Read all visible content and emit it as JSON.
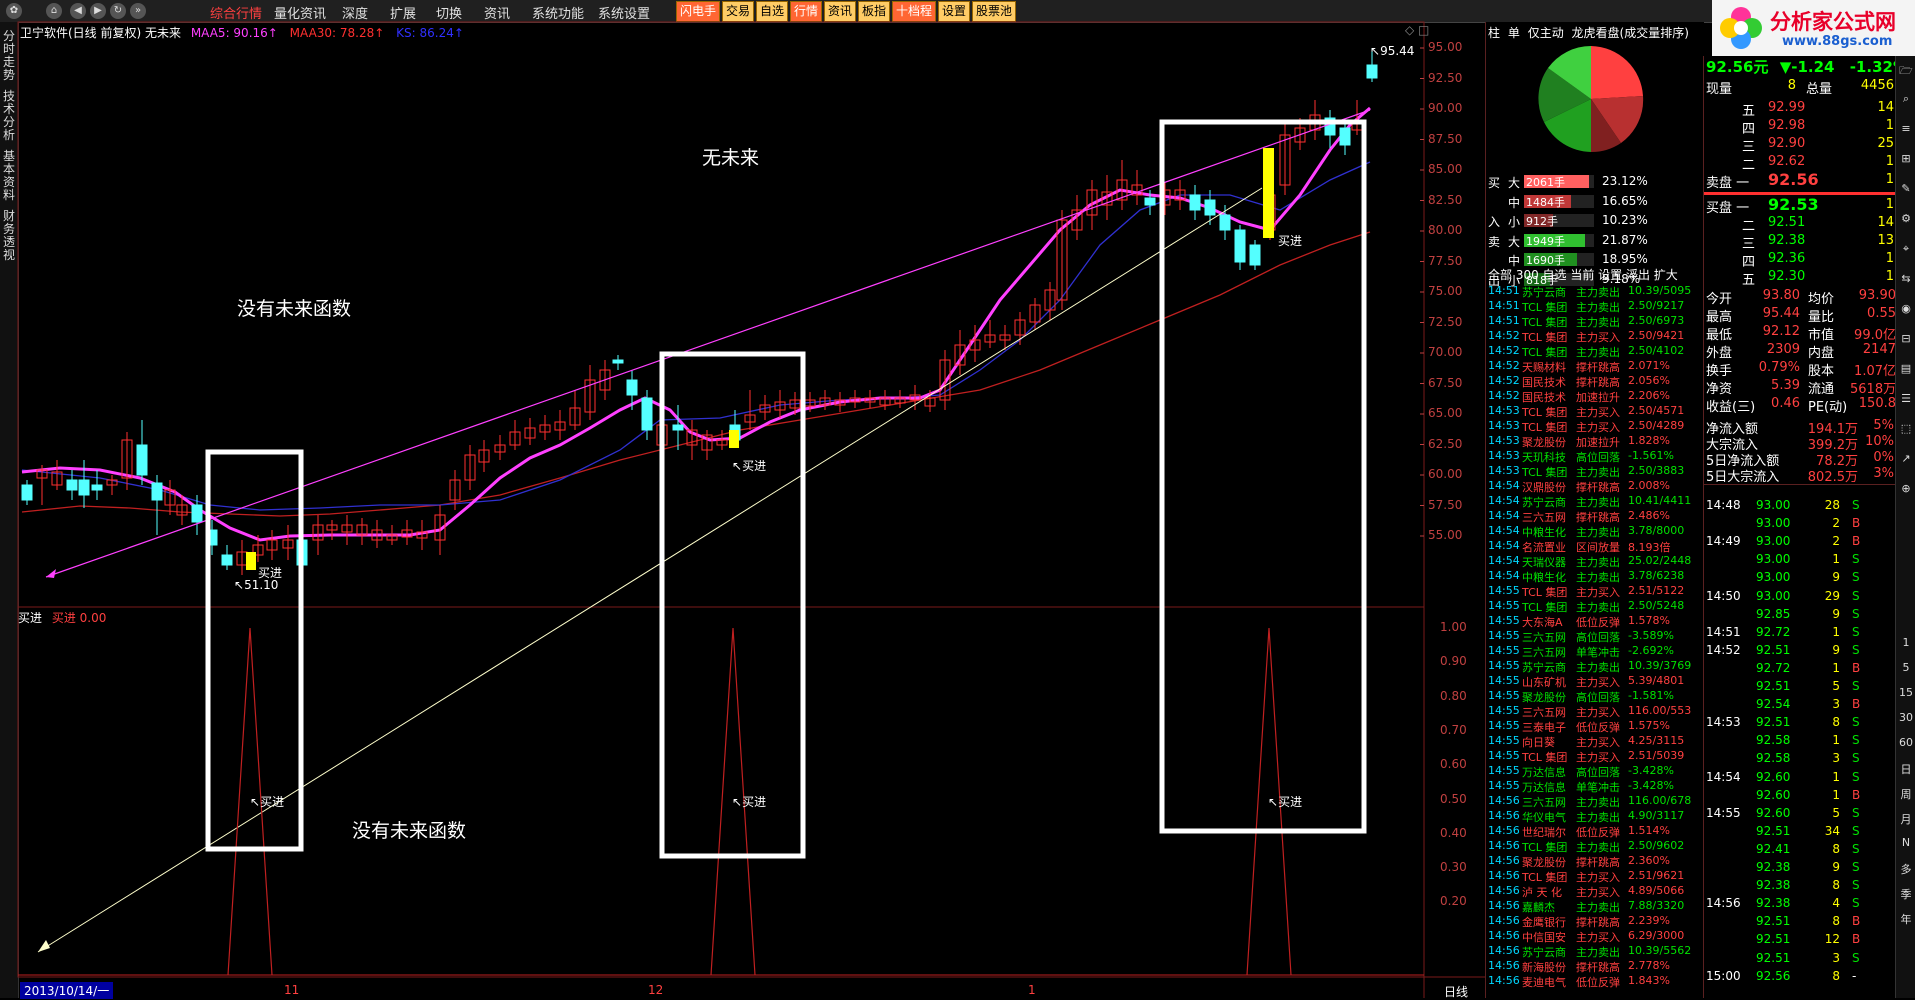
{
  "menu": {
    "items": [
      "综合行情",
      "量化资讯",
      "深度",
      "扩展",
      "切换",
      "资讯",
      "系统功能",
      "系统设置"
    ],
    "active": 0
  },
  "toolbar": {
    "buttons": [
      "闪电手",
      "交易",
      "自选",
      "行情",
      "资讯",
      "板指",
      "十档程",
      "设置",
      "股票池"
    ]
  },
  "logo": {
    "title": "分析家公式网",
    "url": "www.88gs.com"
  },
  "left_tabs": [
    "分时走势",
    "技术分析",
    "基本资料",
    "财务透视"
  ],
  "chart": {
    "title": "卫宁软件(日线 前复权) 无未来",
    "ma5": "MAA5: 90.16↑",
    "ma30": "MAA30: 78.28↑",
    "ks": "KS: 86.24↑",
    "high_label": "95.44",
    "low_label": "51.10",
    "buy_label": "买进",
    "annotation_top": "无未来",
    "annotation_mid": "没有未来函数",
    "annotation_bottom": "没有未来函数",
    "indicator_title": "买进",
    "indicator_value": "买进 0.00",
    "price_ticks": [
      "95.00",
      "92.50",
      "90.00",
      "87.50",
      "85.00",
      "82.50",
      "80.00",
      "77.50",
      "75.00",
      "72.50",
      "70.00",
      "67.50",
      "65.00",
      "62.50",
      "60.00",
      "57.50",
      "55.00"
    ],
    "ind_ticks": [
      "1.00",
      "0.90",
      "0.80",
      "0.70",
      "0.60",
      "0.50",
      "0.40",
      "0.30",
      "0.20"
    ],
    "date_start": "2013/10/14/一",
    "month_labels": [
      "11",
      "12",
      "1"
    ],
    "period": "日线",
    "colors": {
      "up": "#ff3030",
      "down": "#54ffff",
      "ma5": "#ff40ff",
      "ma30": "#c02020",
      "ks": "#3030d0"
    }
  },
  "mid": {
    "tabs": [
      "柱",
      "单",
      "仅主动",
      "龙虎看盘(成交量排序)"
    ],
    "flow": [
      {
        "side": "买",
        "size": "大",
        "vol": "2061手",
        "pct": "23.12%"
      },
      {
        "side": "",
        "size": "中",
        "vol": "1484手",
        "pct": "16.65%"
      },
      {
        "side": "入",
        "size": "小",
        "vol": "912手",
        "pct": "10.23%"
      },
      {
        "side": "卖",
        "size": "大",
        "vol": "1949手",
        "pct": "21.87%"
      },
      {
        "side": "",
        "size": "中",
        "vol": "1690手",
        "pct": "18.95%"
      },
      {
        "side": "出",
        "size": "小",
        "vol": "818手",
        "pct": "9.18%"
      }
    ],
    "filter": "全部  300  自选  当前  设置  浮出  扩大",
    "tape": [
      [
        "14:51",
        "苏宁云商",
        "主力卖出",
        "10.39/5095"
      ],
      [
        "14:51",
        "TCL 集团",
        "主力卖出",
        "2.50/9217"
      ],
      [
        "14:51",
        "TCL 集团",
        "主力卖出",
        "2.50/6973"
      ],
      [
        "14:52",
        "TCL 集团",
        "主力买入",
        "2.50/9421"
      ],
      [
        "14:52",
        "TCL 集团",
        "主力卖出",
        "2.50/4102"
      ],
      [
        "14:52",
        "天赐材料",
        "撑杆跳高",
        "2.071%"
      ],
      [
        "14:52",
        "国民技术",
        "撑杆跳高",
        "2.056%"
      ],
      [
        "14:52",
        "国民技术",
        "加速拉升",
        "2.206%"
      ],
      [
        "14:53",
        "TCL 集团",
        "主力买入",
        "2.50/4571"
      ],
      [
        "14:53",
        "TCL 集团",
        "主力买入",
        "2.50/4289"
      ],
      [
        "14:53",
        "聚龙股份",
        "加速拉升",
        "1.828%"
      ],
      [
        "14:53",
        "天玑科技",
        "高位回落",
        "-1.561%"
      ],
      [
        "14:53",
        "TCL 集团",
        "主力卖出",
        "2.50/3883"
      ],
      [
        "14:54",
        "汉鼎股份",
        "撑杆跳高",
        "2.008%"
      ],
      [
        "14:54",
        "苏宁云商",
        "主力卖出",
        "10.41/4411"
      ],
      [
        "14:54",
        "三六五网",
        "撑杆跳高",
        "2.486%"
      ],
      [
        "14:54",
        "中粮生化",
        "主力卖出",
        "3.78/8000"
      ],
      [
        "14:54",
        "名流置业",
        "区间放量",
        "8.193倍"
      ],
      [
        "14:54",
        "天瑞仪器",
        "主力卖出",
        "25.02/2448"
      ],
      [
        "14:54",
        "中粮生化",
        "主力卖出",
        "3.78/6238"
      ],
      [
        "14:55",
        "TCL 集团",
        "主力买入",
        "2.51/5122"
      ],
      [
        "14:55",
        "TCL 集团",
        "主力卖出",
        "2.50/5248"
      ],
      [
        "14:55",
        "大东海A",
        "低位反弹",
        "1.578%"
      ],
      [
        "14:55",
        "三六五网",
        "高位回落",
        "-3.589%"
      ],
      [
        "14:55",
        "三六五网",
        "单笔冲击",
        "-2.692%"
      ],
      [
        "14:55",
        "苏宁云商",
        "主力卖出",
        "10.39/3769"
      ],
      [
        "14:55",
        "山东矿机",
        "主力买入",
        "5.39/4801"
      ],
      [
        "14:55",
        "聚龙股份",
        "高位回落",
        "-1.581%"
      ],
      [
        "14:55",
        "三六五网",
        "主力买入",
        "116.00/553"
      ],
      [
        "14:55",
        "三泰电子",
        "低位反弹",
        "1.575%"
      ],
      [
        "14:55",
        "向日葵",
        "主力买入",
        "4.25/3115"
      ],
      [
        "14:55",
        "TCL 集团",
        "主力买入",
        "2.51/5039"
      ],
      [
        "14:55",
        "万达信息",
        "高位回落",
        "-3.428%"
      ],
      [
        "14:55",
        "万达信息",
        "单笔冲击",
        "-3.428%"
      ],
      [
        "14:56",
        "三六五网",
        "主力卖出",
        "116.00/678"
      ],
      [
        "14:56",
        "华仪电气",
        "主力卖出",
        "4.90/3117"
      ],
      [
        "14:56",
        "世纪瑞尔",
        "低位反弹",
        "1.514%"
      ],
      [
        "14:56",
        "TCL 集团",
        "主力卖出",
        "2.50/9602"
      ],
      [
        "14:56",
        "聚龙股份",
        "撑杆跳高",
        "2.360%"
      ],
      [
        "14:56",
        "TCL 集团",
        "主力买入",
        "2.51/9621"
      ],
      [
        "14:56",
        "泸 天 化",
        "主力买入",
        "4.89/5066"
      ],
      [
        "14:56",
        "嘉麟杰",
        "主力卖出",
        "7.88/3320"
      ],
      [
        "14:56",
        "金鹰银行",
        "撑杆跳高",
        "2.239%"
      ],
      [
        "14:56",
        "中信国安",
        "主力买入",
        "6.29/3000"
      ],
      [
        "14:56",
        "苏宁云商",
        "主力卖出",
        "10.39/5562"
      ],
      [
        "14:56",
        "新海股份",
        "撑杆跳高",
        "2.778%"
      ],
      [
        "14:56",
        "麦迪电气",
        "低位反弹",
        "1.843%"
      ]
    ]
  },
  "quote": {
    "price": "92.56元",
    "change": "▼-1.24",
    "pct": "-1.32%",
    "now_label": "现量",
    "now": "8",
    "total_label": "总量",
    "total": "4456",
    "asks": [
      [
        "五",
        "92.99",
        "14"
      ],
      [
        "四",
        "92.98",
        "1"
      ],
      [
        "三",
        "92.90",
        "25"
      ],
      [
        "二",
        "92.62",
        "1"
      ],
      [
        "卖盘 一",
        "92.56",
        "1"
      ]
    ],
    "bids": [
      [
        "买盘 一",
        "92.53",
        "1"
      ],
      [
        "二",
        "92.51",
        "14"
      ],
      [
        "三",
        "92.38",
        "13"
      ],
      [
        "四",
        "92.36",
        "1"
      ],
      [
        "五",
        "92.30",
        "1"
      ]
    ],
    "stats": [
      [
        "今开",
        "93.80",
        "均价",
        "93.90"
      ],
      [
        "最高",
        "95.44",
        "量比",
        "0.55"
      ],
      [
        "最低",
        "92.12",
        "市值",
        "99.0亿"
      ],
      [
        "外盘",
        "2309",
        "内盘",
        "2147"
      ],
      [
        "换手",
        "0.79%",
        "股本",
        "1.07亿"
      ],
      [
        "净资",
        "5.39",
        "流通",
        "5618万"
      ],
      [
        "收益(三)",
        "0.46",
        "PE(动)",
        "150.8"
      ]
    ],
    "flows": [
      [
        "净流入额",
        "194.1万",
        "5%"
      ],
      [
        "大宗流入",
        "399.2万",
        "10%"
      ],
      [
        "5日净流入额",
        "78.2万",
        "0%"
      ],
      [
        "5日大宗流入",
        "802.5万",
        "3%"
      ]
    ],
    "ticks": [
      [
        "14:48",
        "93.00",
        "28",
        "S"
      ],
      [
        "",
        "93.00",
        "2",
        "B"
      ],
      [
        "14:49",
        "93.00",
        "2",
        "B"
      ],
      [
        "",
        "93.00",
        "1",
        "S"
      ],
      [
        "",
        "93.00",
        "9",
        "S"
      ],
      [
        "14:50",
        "93.00",
        "29",
        "S"
      ],
      [
        "",
        "92.85",
        "9",
        "S"
      ],
      [
        "14:51",
        "92.72",
        "1",
        "S"
      ],
      [
        "14:52",
        "92.51",
        "9",
        "S"
      ],
      [
        "",
        "92.72",
        "1",
        "B"
      ],
      [
        "",
        "92.51",
        "5",
        "S"
      ],
      [
        "",
        "92.54",
        "3",
        "B"
      ],
      [
        "14:53",
        "92.51",
        "8",
        "S"
      ],
      [
        "",
        "92.58",
        "1",
        "S"
      ],
      [
        "",
        "92.58",
        "3",
        "S"
      ],
      [
        "14:54",
        "92.60",
        "1",
        "S"
      ],
      [
        "",
        "92.60",
        "1",
        "B"
      ],
      [
        "14:55",
        "92.60",
        "5",
        "S"
      ],
      [
        "",
        "92.51",
        "34",
        "S"
      ],
      [
        "",
        "92.41",
        "8",
        "S"
      ],
      [
        "",
        "92.38",
        "9",
        "S"
      ],
      [
        "",
        "92.38",
        "8",
        "S"
      ],
      [
        "14:56",
        "92.38",
        "4",
        "S"
      ],
      [
        "",
        "92.51",
        "8",
        "B"
      ],
      [
        "",
        "92.51",
        "12",
        "B"
      ],
      [
        "",
        "92.51",
        "3",
        "S"
      ],
      [
        "15:00",
        "92.56",
        "8",
        "-"
      ]
    ]
  },
  "vnav": [
    "1",
    "5",
    "15",
    "30",
    "60",
    "日",
    "周",
    "月",
    "N",
    "多",
    "季",
    "年"
  ]
}
